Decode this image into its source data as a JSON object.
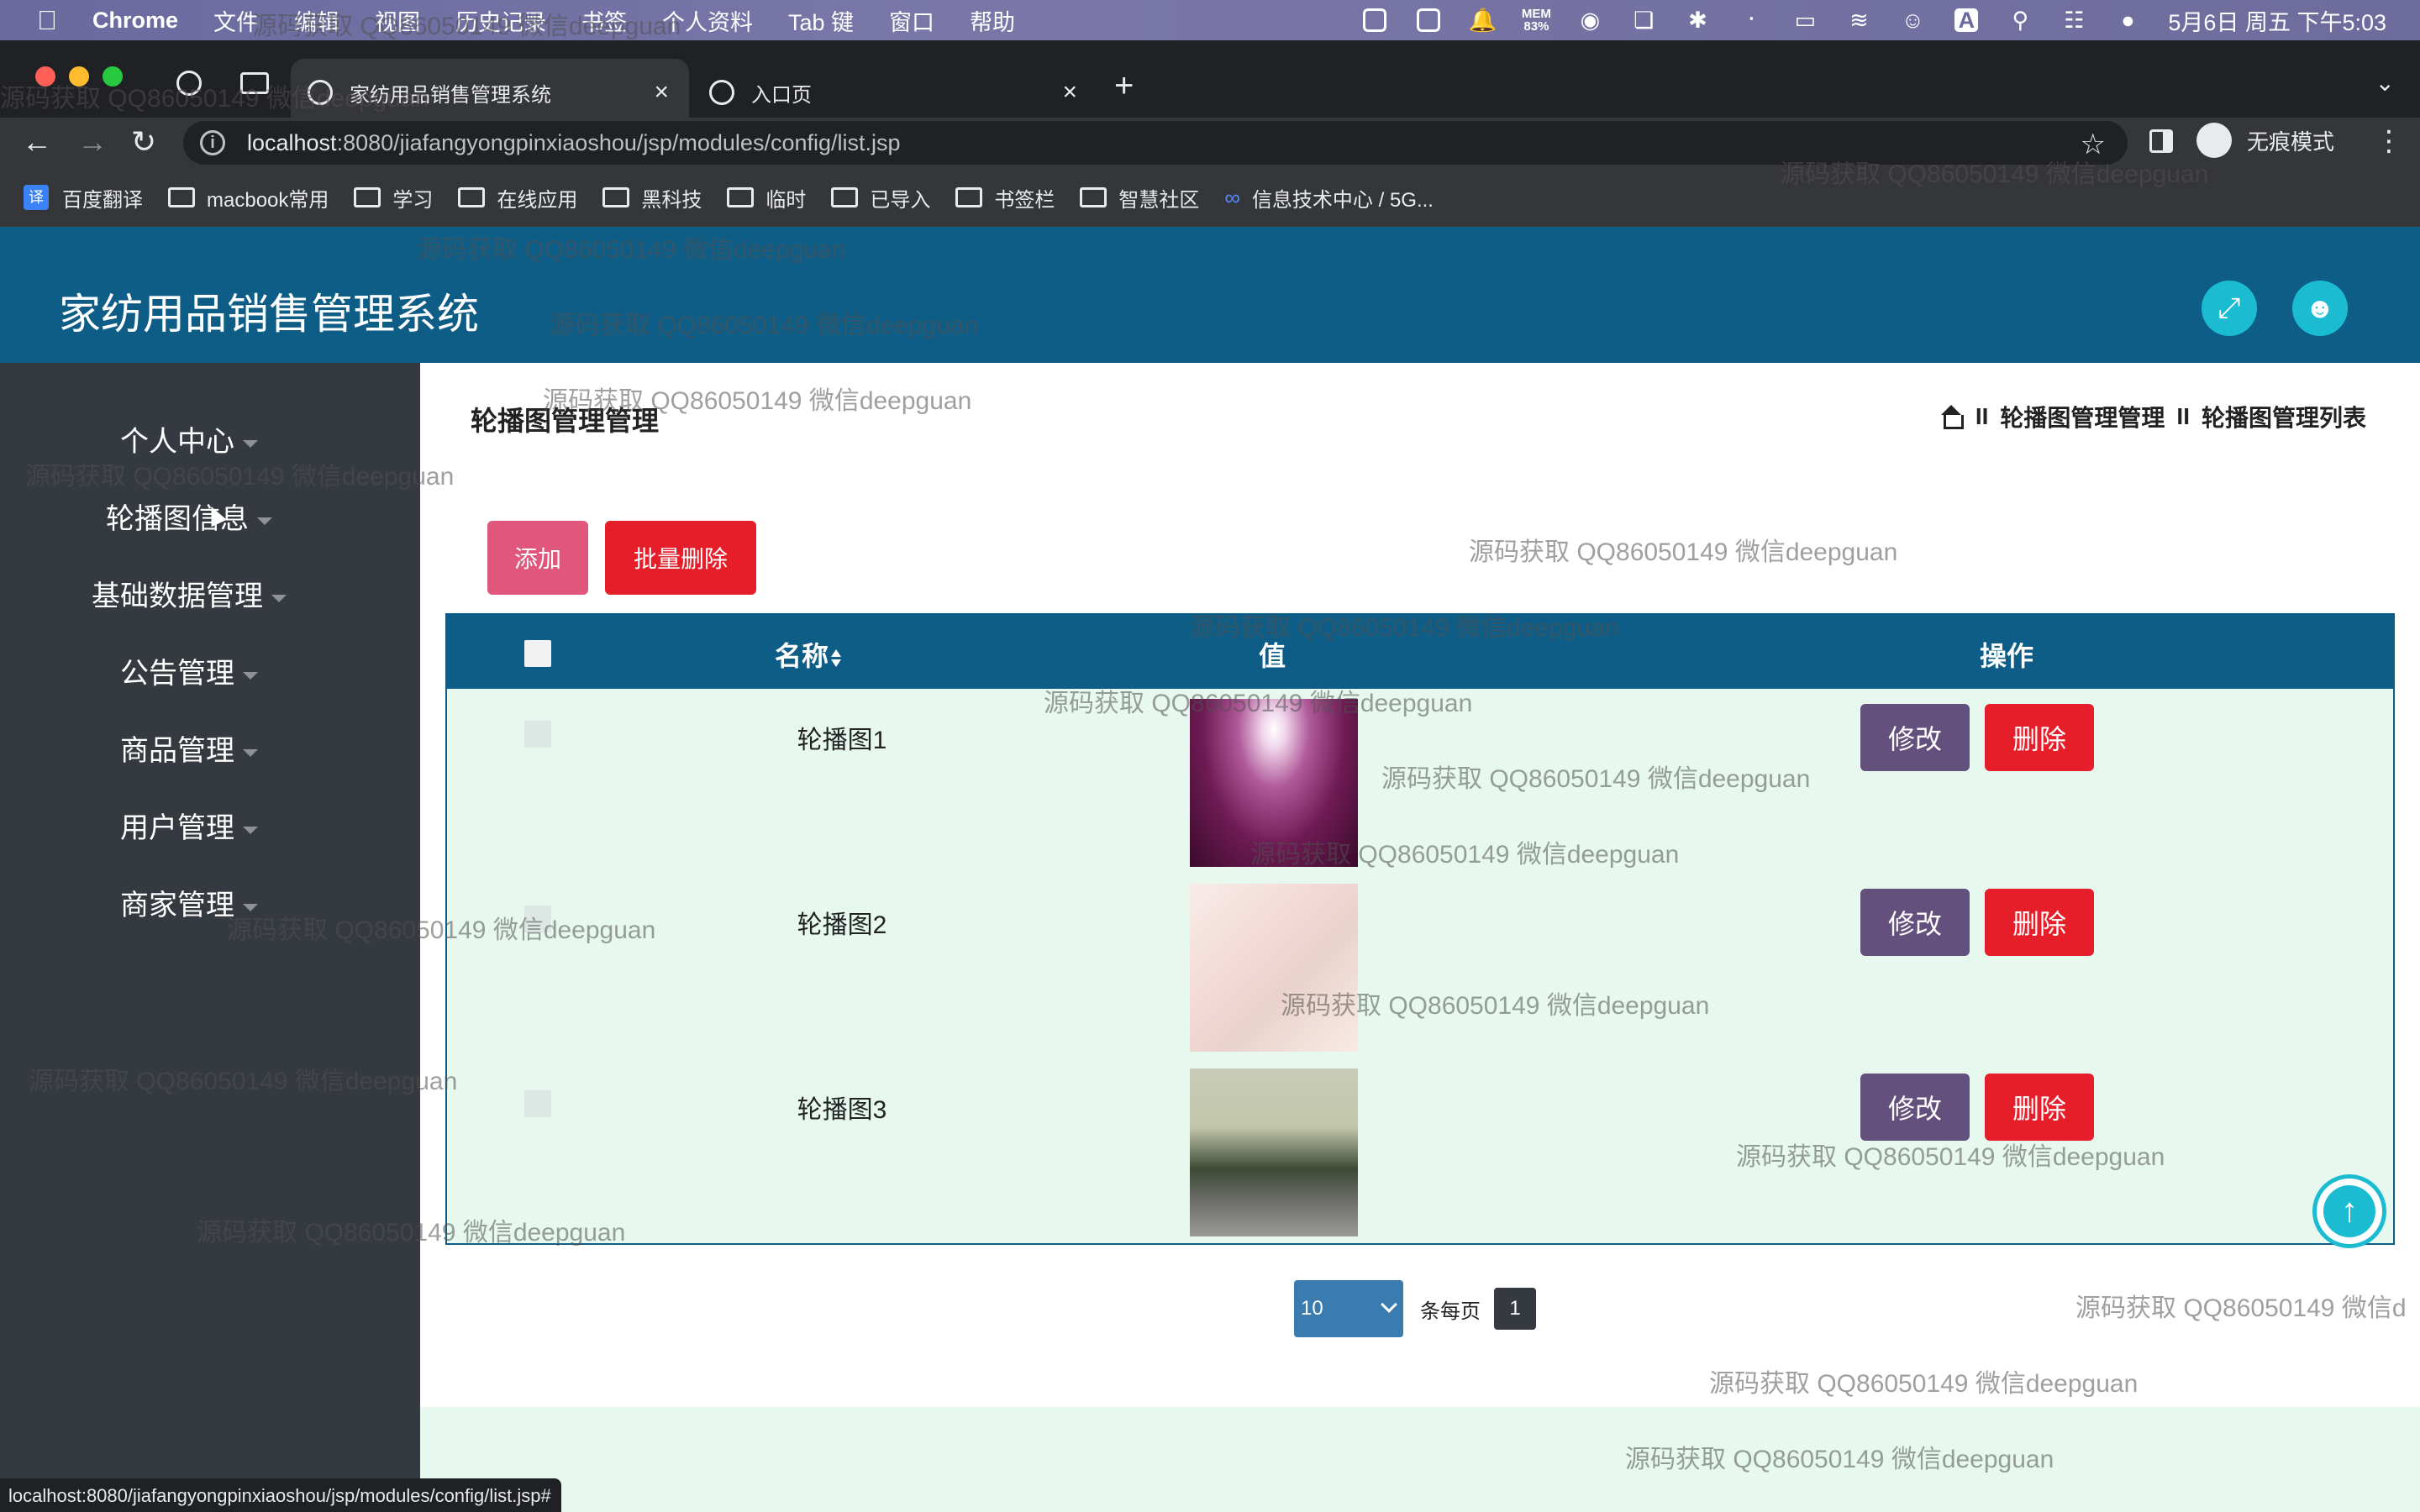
{
  "menubar": {
    "app": "Chrome",
    "items": [
      "文件",
      "编辑",
      "视图",
      "历史记录",
      "书签",
      "个人资料",
      "Tab 键",
      "窗口",
      "帮助"
    ],
    "mem_label": "MEM",
    "mem_value": "83%",
    "input_badge": "A",
    "clock": "5月6日 周五 下午5:03",
    "tray_icons": [
      "stop-icon",
      "word-icon",
      "bell-icon",
      "mem-icon",
      "1password-icon",
      "screen-icon",
      "network-icon",
      "bluetooth-icon",
      "battery-icon",
      "wifi-icon",
      "user-icon",
      "input-method-icon",
      "search-icon",
      "control-center-icon",
      "siri-icon"
    ]
  },
  "browser": {
    "tabs": [
      {
        "title": "家纺用品销售管理系统",
        "active": true
      },
      {
        "title": "入口页",
        "active": false
      }
    ],
    "url_host": "localhost",
    "url_rest": ":8080/jiafangyongpinxiaoshou/jsp/modules/config/list.jsp",
    "profile_label": "无痕模式",
    "bookmarks": [
      "百度翻译",
      "macbook常用",
      "学习",
      "在线应用",
      "黑科技",
      "临时",
      "已导入",
      "书签栏",
      "智慧社区",
      "信息技术中心 / 5G..."
    ],
    "status_url": "localhost:8080/jiafangyongpinxiaoshou/jsp/modules/config/list.jsp#"
  },
  "site": {
    "title": "家纺用品销售管理系统"
  },
  "sidebar": {
    "items": [
      {
        "label": "个人中心"
      },
      {
        "label": "轮播图信息"
      },
      {
        "label": "基础数据管理"
      },
      {
        "label": "公告管理"
      },
      {
        "label": "商品管理"
      },
      {
        "label": "用户管理"
      },
      {
        "label": "商家管理"
      }
    ]
  },
  "main": {
    "heading": "轮播图管理管理",
    "breadcrumb": [
      "轮播图管理管理",
      "轮播图管理列表"
    ],
    "breadcrumb_sep": "II",
    "add_label": "添加",
    "bulk_delete_label": "批量删除",
    "columns": [
      "名称",
      "值",
      "操作"
    ],
    "rows": [
      {
        "name": "轮播图1",
        "edit": "修改",
        "delete": "删除"
      },
      {
        "name": "轮播图2",
        "edit": "修改",
        "delete": "删除"
      },
      {
        "name": "轮播图3",
        "edit": "修改",
        "delete": "删除"
      }
    ],
    "pager": {
      "page_size": "10",
      "per_page_label": "条每页",
      "current_page": "1"
    }
  },
  "watermark_text": "源码获取 QQ86050149 微信deepguan",
  "watermark_text_cut": "源码获取 QQ86050149 微信d",
  "colors": {
    "header": "#0e5d87",
    "sidebar": "#343a40",
    "add_button": "#e0567c",
    "delete_button": "#e61e2a",
    "edit_button": "#64507c",
    "accent": "#1bbcd1",
    "row_bg": "#e7f8ef"
  }
}
